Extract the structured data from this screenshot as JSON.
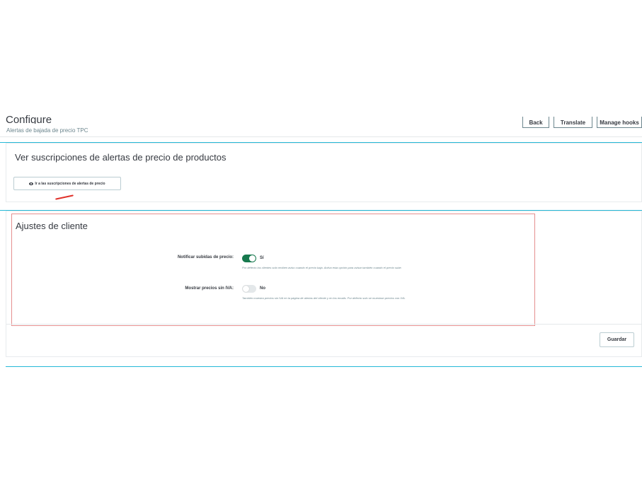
{
  "header": {
    "title": "Configure",
    "subtitle": "Alertas de bajada de precio TPC",
    "buttons": {
      "back": "Back",
      "translate": "Translate",
      "manage_hooks": "Manage hooks"
    }
  },
  "subscriptions_panel": {
    "title": "Ver suscripciones de alertas de precio de productos",
    "link_label": "Ir a las suscripciones de alertas de precio",
    "link_icon": "eye-icon"
  },
  "settings_panel": {
    "title": "Ajustes de cliente",
    "fields": [
      {
        "label": "Notificar subidas de precio:",
        "state": "Sí",
        "enabled": true,
        "help": "Por defecto los clientes solo reciben aviso cuando el precio baja. Activa esta opción para avisar también cuando el precio sube."
      },
      {
        "label": "Mostrar precios sin IVA:",
        "state": "No",
        "enabled": false,
        "help": "También muestra precios sin IVA en la página de alertas del cliente y en los emails. Por defecto solo se muestran precios con IVA."
      }
    ],
    "save_label": "Guardar"
  },
  "colors": {
    "accent": "#25b9d7",
    "toggle_on": "#17794e",
    "annotation": "#e0312a"
  }
}
